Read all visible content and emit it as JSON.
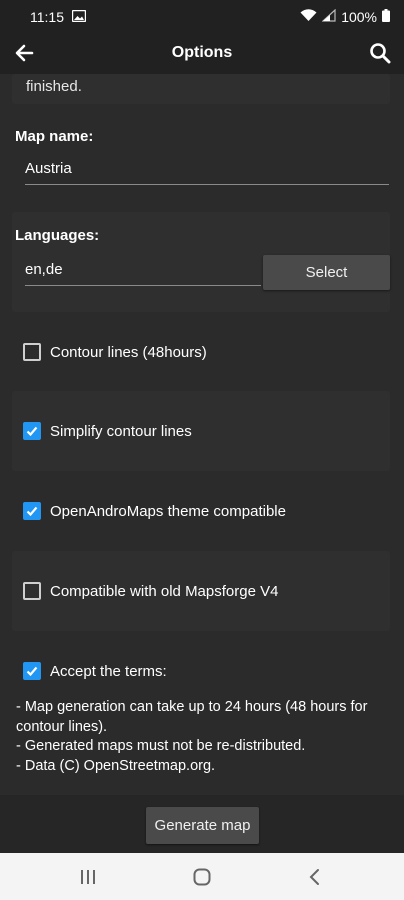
{
  "status_bar": {
    "time": "11:15",
    "battery": "100%",
    "icons": [
      "image-icon",
      "wifi-icon",
      "signal-icon",
      "battery-icon"
    ]
  },
  "app_bar": {
    "title": "Options",
    "icons": [
      "back-arrow-icon",
      "search-icon"
    ]
  },
  "partial_text": "finished.",
  "map_name": {
    "label": "Map name:",
    "value": "Austria"
  },
  "languages": {
    "label": "Languages:",
    "value": "en,de",
    "select_label": "Select"
  },
  "options": [
    {
      "label": "Contour lines (48hours)",
      "checked": false
    },
    {
      "label": "Simplify contour lines",
      "checked": true
    },
    {
      "label": "OpenAndroMaps theme compatible",
      "checked": true
    },
    {
      "label": "Compatible with old Mapsforge V4",
      "checked": false
    }
  ],
  "terms": {
    "label": "Accept the terms:",
    "checked": true,
    "lines": [
      "- Map generation can take up to 24 hours (48 hours for contour lines).",
      "- Generated maps must not be re-distributed.",
      "- Data (C) OpenStreetmap.org."
    ]
  },
  "generate_label": "Generate map",
  "nav_bar": {
    "icons": [
      "recent-apps-icon",
      "home-icon",
      "back-icon"
    ]
  },
  "colors": {
    "accent": "#2196f3",
    "background": "#2b2b2b",
    "bar": "#212121",
    "button": "#4a4a4a"
  }
}
